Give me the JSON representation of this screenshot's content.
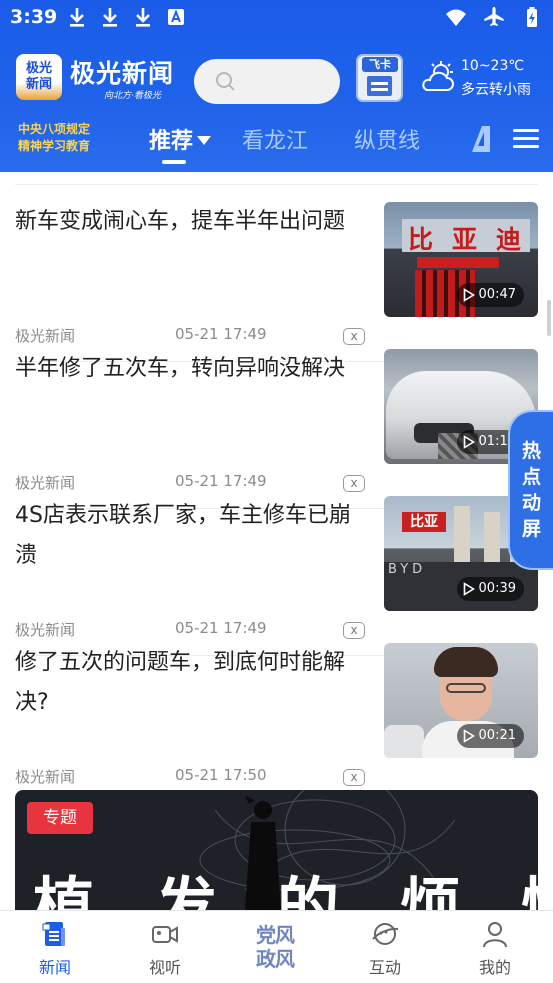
{
  "status_bar": {
    "time": "3:39",
    "left_icons": [
      "download-icon",
      "download-icon",
      "download-icon",
      "notification-a-icon"
    ],
    "right_icons": [
      "wifi-icon",
      "airplane-icon",
      "battery-charging-icon"
    ]
  },
  "header": {
    "logo_badge_line1": "极光",
    "logo_badge_line2": "新闻",
    "app_name": "极光新闻",
    "slogan": "向北方·看极光",
    "search_icon": "search-icon",
    "feika_label": "飞卡",
    "weather": {
      "icon": "partly-cloudy-icon",
      "temp": "10~23℃",
      "desc": "多云转小雨"
    }
  },
  "nav_tabs": {
    "campaign_line1": "中央八项规定",
    "campaign_line2": "精神学习教育",
    "tabs": [
      {
        "label": "推荐",
        "active": true
      },
      {
        "label": "看龙江",
        "active": false
      },
      {
        "label": "纵贯线",
        "active": false
      }
    ],
    "menu_icon": "menu-icon"
  },
  "feed": {
    "items": [
      {
        "title": "新车变成闹心车，提车半年出问题",
        "source": "极光新闻",
        "time": "05-21 17:49",
        "duration": "00:47"
      },
      {
        "title": "半年修了五次车，转向异响没解决",
        "source": "极光新闻",
        "time": "05-21 17:49",
        "duration": "01:17"
      },
      {
        "title": "4S店表示联系厂家，车主修车已崩溃",
        "source": "极光新闻",
        "time": "05-21 17:49",
        "duration": "00:39"
      },
      {
        "title": "修了五次的问题车，到底何时能解决?",
        "source": "极光新闻",
        "time": "05-21 17:50",
        "duration": "00:21"
      }
    ],
    "thumb1_sign": [
      "比",
      "亚",
      "迪"
    ],
    "thumb3_sign": "比亚",
    "thumb3_wall": "BYD",
    "banner": {
      "tag": "专题",
      "title": "植发的烦恼"
    },
    "close_symbol": "x"
  },
  "hot_tab": {
    "label": "热点动屏"
  },
  "bottom_nav": [
    {
      "label": "新闻",
      "icon": "news-icon",
      "active": true
    },
    {
      "label": "视听",
      "icon": "video-camera-icon",
      "active": false
    },
    {
      "label": "党风政风",
      "icon": "",
      "active": false
    },
    {
      "label": "互动",
      "icon": "chat-planet-icon",
      "active": false
    },
    {
      "label": "我的",
      "icon": "person-icon",
      "active": false
    }
  ],
  "colors": {
    "header_blue": "#1f62ea",
    "accent_red": "#e8343f",
    "campaign_yellow": "#ffd34a",
    "nav_active": "#1c5fe6"
  }
}
